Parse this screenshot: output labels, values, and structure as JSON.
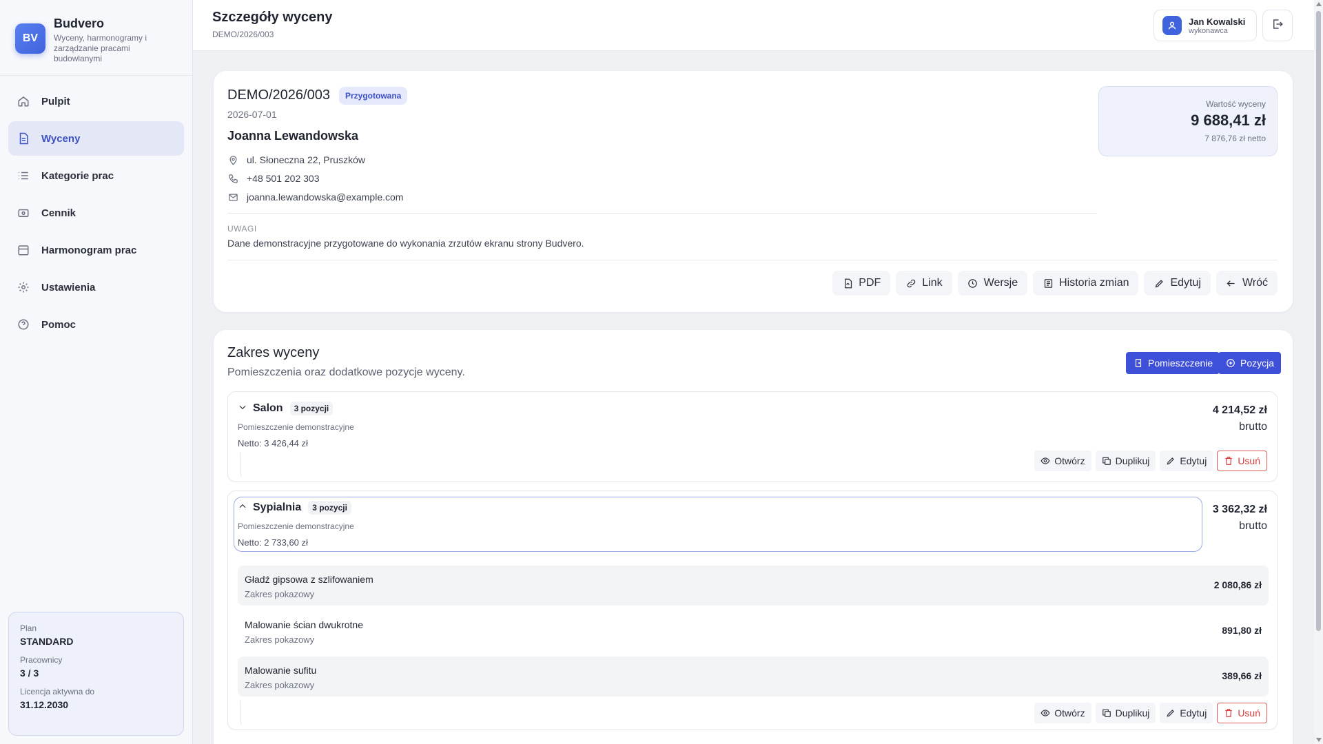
{
  "app": {
    "name": "Budvero",
    "logo_text": "BV",
    "tagline": "Wyceny, harmonogramy i zarządzanie pracami budowlanymi"
  },
  "sidebar": {
    "items": [
      {
        "label": "Pulpit",
        "icon": "home-icon",
        "active": false
      },
      {
        "label": "Wyceny",
        "icon": "document-icon",
        "active": true
      },
      {
        "label": "Kategorie prac",
        "icon": "list-icon",
        "active": false
      },
      {
        "label": "Cennik",
        "icon": "price-tag-icon",
        "active": false
      },
      {
        "label": "Harmonogram prac",
        "icon": "calendar-icon",
        "active": false
      },
      {
        "label": "Ustawienia",
        "icon": "gear-icon",
        "active": false
      },
      {
        "label": "Pomoc",
        "icon": "help-icon",
        "active": false
      }
    ],
    "plan": {
      "plan_label": "Plan",
      "plan_value": "STANDARD",
      "workers_label": "Pracownicy",
      "workers_value": "3 / 3",
      "license_label": "Licencja aktywna do",
      "license_value": "31.12.2030"
    }
  },
  "header": {
    "title": "Szczegóły wyceny",
    "subtitle": "DEMO/2026/003",
    "user_name": "Jan Kowalski",
    "user_role": "wykonawca"
  },
  "quote": {
    "number": "DEMO/2026/003",
    "status": "Przygotowana",
    "date": "2026-07-01",
    "client_name": "Joanna Lewandowska",
    "address": "ul. Słoneczna 22, Pruszków",
    "phone": "+48 501 202 303",
    "email": "joanna.lewandowska@example.com",
    "notes_label": "UWAGI",
    "notes": "Dane demonstracyjne przygotowane do wykonania zrzutów ekranu strony Budvero.",
    "value_label": "Wartość wyceny",
    "value_gross": "9 688,41 zł",
    "value_net": "7 876,76 zł netto",
    "actions": {
      "pdf": "PDF",
      "link": "Link",
      "versions": "Wersje",
      "history": "Historia zmian",
      "edit": "Edytuj",
      "back": "Wróć"
    }
  },
  "scope": {
    "title": "Zakres wyceny",
    "subtitle": "Pomieszczenia oraz dodatkowe pozycje wyceny.",
    "add_room": "Pomieszczenie",
    "add_position": "Pozycja",
    "room_actions": {
      "open": "Otwórz",
      "duplicate": "Duplikuj",
      "edit": "Edytuj",
      "delete": "Usuń"
    },
    "rooms": [
      {
        "name": "Salon",
        "count": "3 pozycji",
        "description": "Pomieszczenie demonstracyjne",
        "net": "Netto: 3 426,44 zł",
        "total": "4 214,52 zł",
        "brutto": "brutto",
        "expanded": false
      },
      {
        "name": "Sypialnia",
        "count": "3 pozycji",
        "description": "Pomieszczenie demonstracyjne",
        "net": "Netto: 2 733,60 zł",
        "total": "3 362,32 zł",
        "brutto": "brutto",
        "expanded": true,
        "positions": [
          {
            "name": "Gładź gipsowa z szlifowaniem",
            "scope": "Zakres pokazowy",
            "price": "2 080,86 zł"
          },
          {
            "name": "Malowanie ścian dwukrotne",
            "scope": "Zakres pokazowy",
            "price": "891,80 zł"
          },
          {
            "name": "Malowanie sufitu",
            "scope": "Zakres pokazowy",
            "price": "389,66 zł"
          }
        ]
      }
    ]
  },
  "colors": {
    "accent": "#3e4fd8",
    "active_nav_bg": "#e4e7f6",
    "danger": "#d63b3b"
  }
}
